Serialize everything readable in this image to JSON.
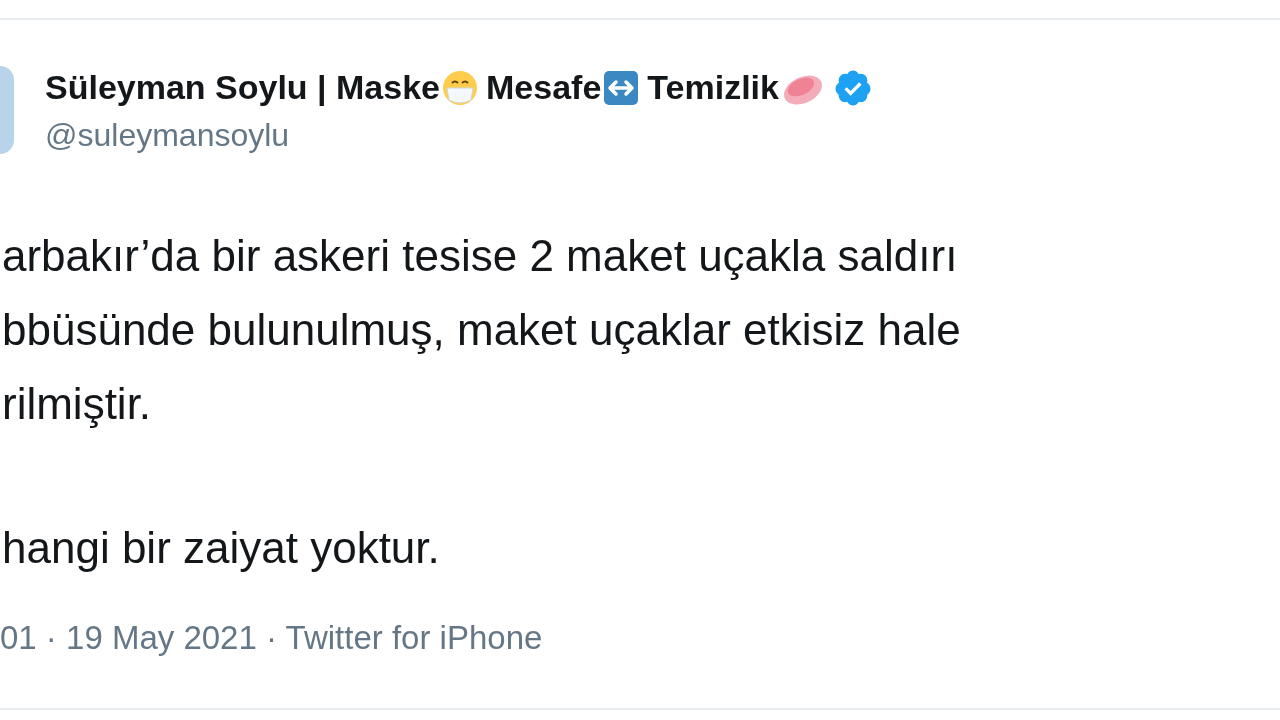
{
  "author": {
    "name": "Süleyman Soylu | Maske",
    "parts": [
      {
        "kind": "mask",
        "text": "Mesafe"
      },
      {
        "kind": "arrows",
        "text": "Temizlik"
      },
      {
        "kind": "soap"
      }
    ],
    "verified": true,
    "handle": "@suleymansoylu"
  },
  "paragraphs": [
    [
      "arbakır’da bir askeri tesise 2 maket uçakla saldırı",
      "bbüsünde bulunulmuş, maket uçaklar etkisiz hale",
      "rilmiştir."
    ],
    [
      "hangi bir zaiyat yoktur."
    ]
  ],
  "footer": "01 · 19 May 2021 · Twitter for iPhone"
}
